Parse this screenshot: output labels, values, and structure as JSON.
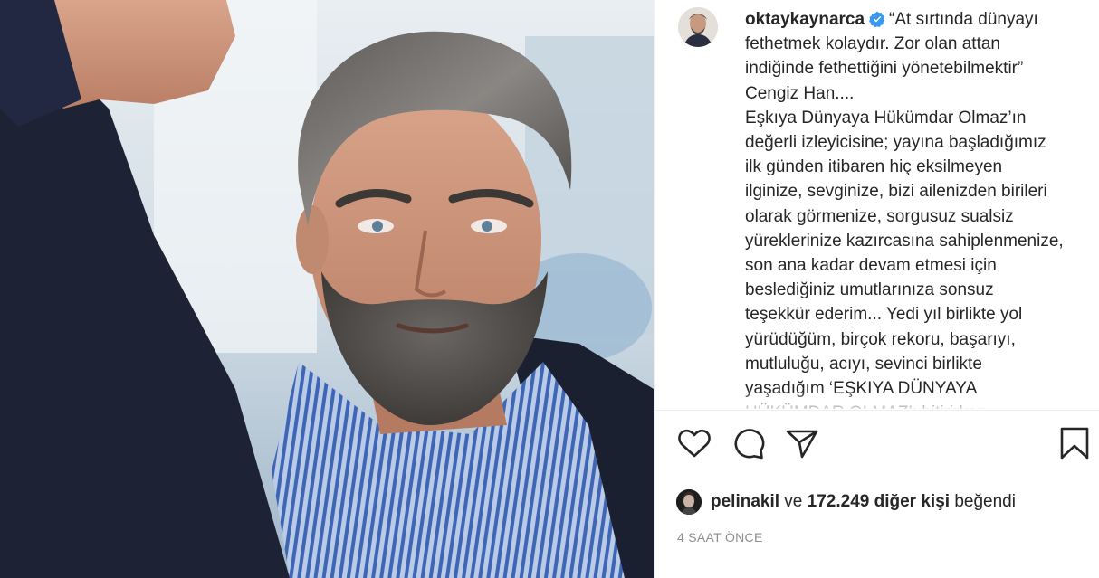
{
  "post": {
    "username": "oktaykaynarca",
    "verified": true,
    "caption": "“At sırtında dünyayı\nfethetmek kolaydır. Zor olan attan\nindiğinde fethettiğini yönetebilmektir”\nCengiz Han....\nEşkıya Dünyaya Hükümdar Olmaz’ın\ndeğerli izleyicisine; yayına başladığımız\nilk günden itibaren hiç eksilmeyen\nilginize, sevginize, bizi ailenizden birileri\nolarak görmenize, sorgusuz sualsiz\nyüreklerinize kazırcasına sahiplenmenize,\nson ana kadar devam etmesi için\nbeslediğiniz umutlarınıza sonsuz\nteşekkür ederim... Yedi yıl birlikte yol\nyürüdüğüm, birçok rekoru, başarıyı,\nmutluluğu, acıyı, sevinci birlikte\nyaşadığım ‘EŞKIYA DÜNYAYA\nHÜKÜMDAR OLMAZ’ı bitirirken",
    "likes": {
      "liker": "pelinakil",
      "connector": " ve ",
      "count_text": "172.249 diğer kişi",
      "suffix": " beğendi"
    },
    "timestamp": "4 SAAT ÖNCE"
  },
  "icons": {
    "like": "heart-icon",
    "comment": "comment-icon",
    "share": "paper-plane-icon",
    "save": "bookmark-icon",
    "verified": "verified-badge-icon"
  },
  "colors": {
    "text": "#262626",
    "muted": "#8e8e8e",
    "verified_blue": "#3897f0",
    "divider": "#efefef"
  }
}
